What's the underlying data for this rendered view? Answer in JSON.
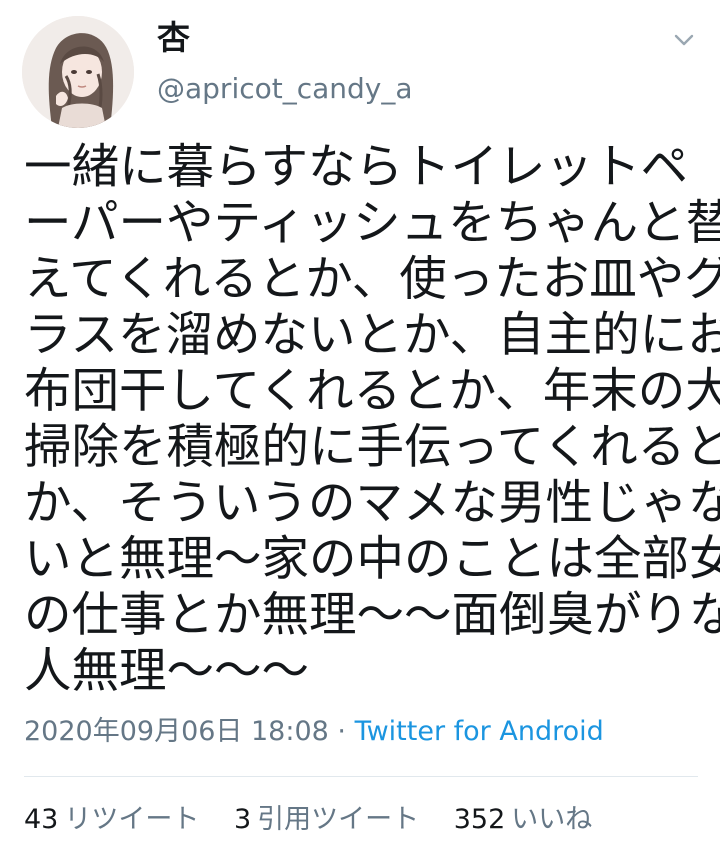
{
  "tweet": {
    "author": {
      "display_name": "杏",
      "handle": "@apricot_candy_a",
      "avatar_icon": "avatar-illustration"
    },
    "text_lines": [
      "一緒に暮らすならトイレットペ",
      "ーパーやティッシュをちゃんと替",
      "えてくれるとか、使ったお皿やグ",
      "ラスを溜めないとか、自主的にお",
      "布団干してくれるとか、年末の大",
      "掃除を積極的に手伝ってくれると",
      "か、そういうのマメな男性じゃな",
      "いと無理〜家の中のことは全部女",
      "の仕事とか無理〜〜面倒臭がりな",
      "人無理〜〜〜"
    ],
    "timestamp": "2020年09月06日 18:08",
    "separator": " · ",
    "client": "Twitter for Android",
    "stats": {
      "retweets": {
        "count": "43",
        "label": "リツイート"
      },
      "quotes": {
        "count": "3",
        "label": "引用ツイート"
      },
      "likes": {
        "count": "352",
        "label": "いいね"
      }
    }
  },
  "colors": {
    "text": "#14171a",
    "secondary": "#657786",
    "link": "#1b95e0",
    "divider": "#e1e8ed"
  },
  "icons": {
    "menu": "chevron-down-icon"
  }
}
